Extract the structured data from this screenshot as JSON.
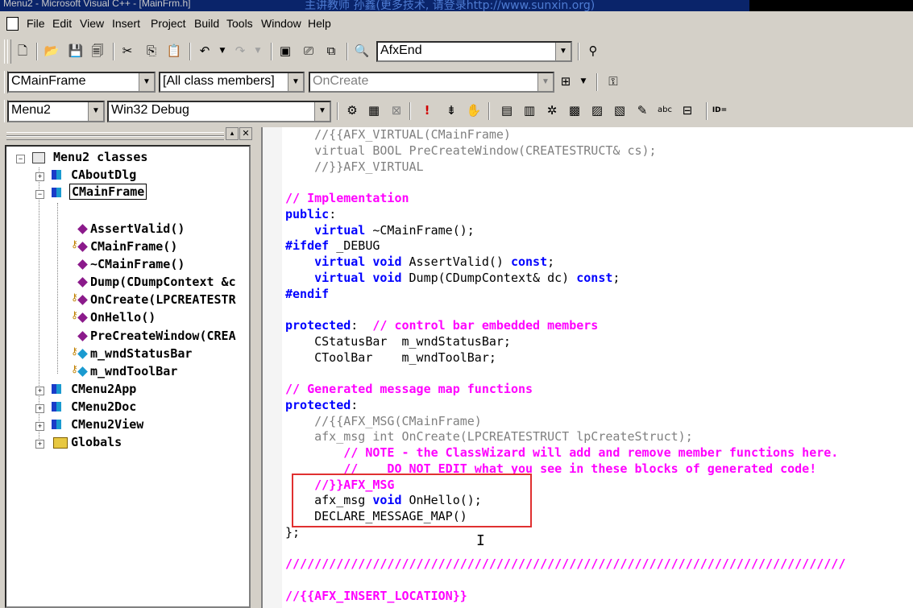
{
  "window": {
    "title": "Menu2 - Microsoft Visual C++ - [MainFrm.h]",
    "overlay_text": "主讲教师 孙鑫(更多技术, 请登录http://www.sunxin.org)"
  },
  "menu": [
    "File",
    "Edit",
    "View",
    "Insert",
    "Project",
    "Build",
    "Tools",
    "Window",
    "Help"
  ],
  "toolbar": {
    "find_combo": "AfxEnd",
    "class_combo": "CMainFrame",
    "filter_combo": "[All class members]",
    "member_combo": "OnCreate",
    "project_combo": "Menu2",
    "config_combo": "Win32 Debug",
    "id_button": "ID="
  },
  "tree": {
    "root": "Menu2 classes",
    "items": [
      {
        "label": "CAboutDlg",
        "type": "class",
        "level": 1
      },
      {
        "label": "CMainFrame",
        "type": "class",
        "level": 1,
        "selected": true
      },
      {
        "label": "AssertValid()",
        "type": "method",
        "level": 2
      },
      {
        "label": "CMainFrame()",
        "type": "method-key",
        "level": 2
      },
      {
        "label": "~CMainFrame()",
        "type": "method",
        "level": 2
      },
      {
        "label": "Dump(CDumpContext &c",
        "type": "method",
        "level": 2
      },
      {
        "label": "OnCreate(LPCREATESTR",
        "type": "method-key",
        "level": 2
      },
      {
        "label": "OnHello()",
        "type": "method-key",
        "level": 2
      },
      {
        "label": "PreCreateWindow(CREA",
        "type": "method",
        "level": 2
      },
      {
        "label": "m_wndStatusBar",
        "type": "field-key",
        "level": 2
      },
      {
        "label": "m_wndToolBar",
        "type": "field-key",
        "level": 2
      },
      {
        "label": "CMenu2App",
        "type": "class",
        "level": 1
      },
      {
        "label": "CMenu2Doc",
        "type": "class",
        "level": 1
      },
      {
        "label": "CMenu2View",
        "type": "class",
        "level": 1
      },
      {
        "label": "Globals",
        "type": "folder",
        "level": 1
      }
    ]
  },
  "code": [
    [
      [
        "    //{{AFX_VIRTUAL(CMainFrame)",
        "gr"
      ]
    ],
    [
      [
        "    virtual BOOL PreCreateWindow(CREATESTRUCT& cs);",
        "gr"
      ]
    ],
    [
      [
        "    //}}AFX_VIRTUAL",
        "gr"
      ]
    ],
    [
      [
        "",
        ""
      ]
    ],
    [
      [
        "// Implementation",
        "cm"
      ]
    ],
    [
      [
        "public",
        "kw"
      ],
      [
        ":",
        "pl"
      ]
    ],
    [
      [
        "    ",
        "pl"
      ],
      [
        "virtual",
        "kw"
      ],
      [
        " ~CMainFrame();",
        "pl"
      ]
    ],
    [
      [
        "#ifdef",
        "kw"
      ],
      [
        " _DEBUG",
        "pl"
      ]
    ],
    [
      [
        "    ",
        "pl"
      ],
      [
        "virtual void",
        "kw"
      ],
      [
        " AssertValid() ",
        "pl"
      ],
      [
        "const",
        "kw"
      ],
      [
        ";",
        "pl"
      ]
    ],
    [
      [
        "    ",
        "pl"
      ],
      [
        "virtual void",
        "kw"
      ],
      [
        " Dump(CDumpContext& dc) ",
        "pl"
      ],
      [
        "const",
        "kw"
      ],
      [
        ";",
        "pl"
      ]
    ],
    [
      [
        "#endif",
        "kw"
      ]
    ],
    [
      [
        "",
        ""
      ]
    ],
    [
      [
        "protected",
        "kw"
      ],
      [
        ":  ",
        "pl"
      ],
      [
        "// control bar embedded members",
        "cm"
      ]
    ],
    [
      [
        "    CStatusBar  m_wndStatusBar;",
        "pl"
      ]
    ],
    [
      [
        "    CToolBar    m_wndToolBar;",
        "pl"
      ]
    ],
    [
      [
        "",
        ""
      ]
    ],
    [
      [
        "// Generated message map functions",
        "cm"
      ]
    ],
    [
      [
        "protected",
        "kw"
      ],
      [
        ":",
        "pl"
      ]
    ],
    [
      [
        "    //{{AFX_MSG(CMainFrame)",
        "gr"
      ]
    ],
    [
      [
        "    afx_msg int OnCreate(LPCREATESTRUCT lpCreateStruct);",
        "gr"
      ]
    ],
    [
      [
        "        // NOTE - the ClassWizard will add and remove member functions here.",
        "cm"
      ]
    ],
    [
      [
        "        //    DO NOT EDIT what you see in these blocks of generated code!",
        "cm"
      ]
    ],
    [
      [
        "    //}}AFX_MSG",
        "cm"
      ]
    ],
    [
      [
        "    afx_msg ",
        "pl"
      ],
      [
        "void",
        "kw"
      ],
      [
        " OnHello();",
        "pl"
      ]
    ],
    [
      [
        "    DECLARE_MESSAGE_MAP()",
        "pl"
      ]
    ],
    [
      [
        "};",
        "pl"
      ]
    ],
    [
      [
        "",
        ""
      ]
    ],
    [
      [
        "/////////////////////////////////////////////////////////////////////////////",
        "cm"
      ]
    ],
    [
      [
        "",
        ""
      ]
    ],
    [
      [
        "//{{AFX_INSERT_LOCATION}}",
        "cm"
      ]
    ]
  ]
}
